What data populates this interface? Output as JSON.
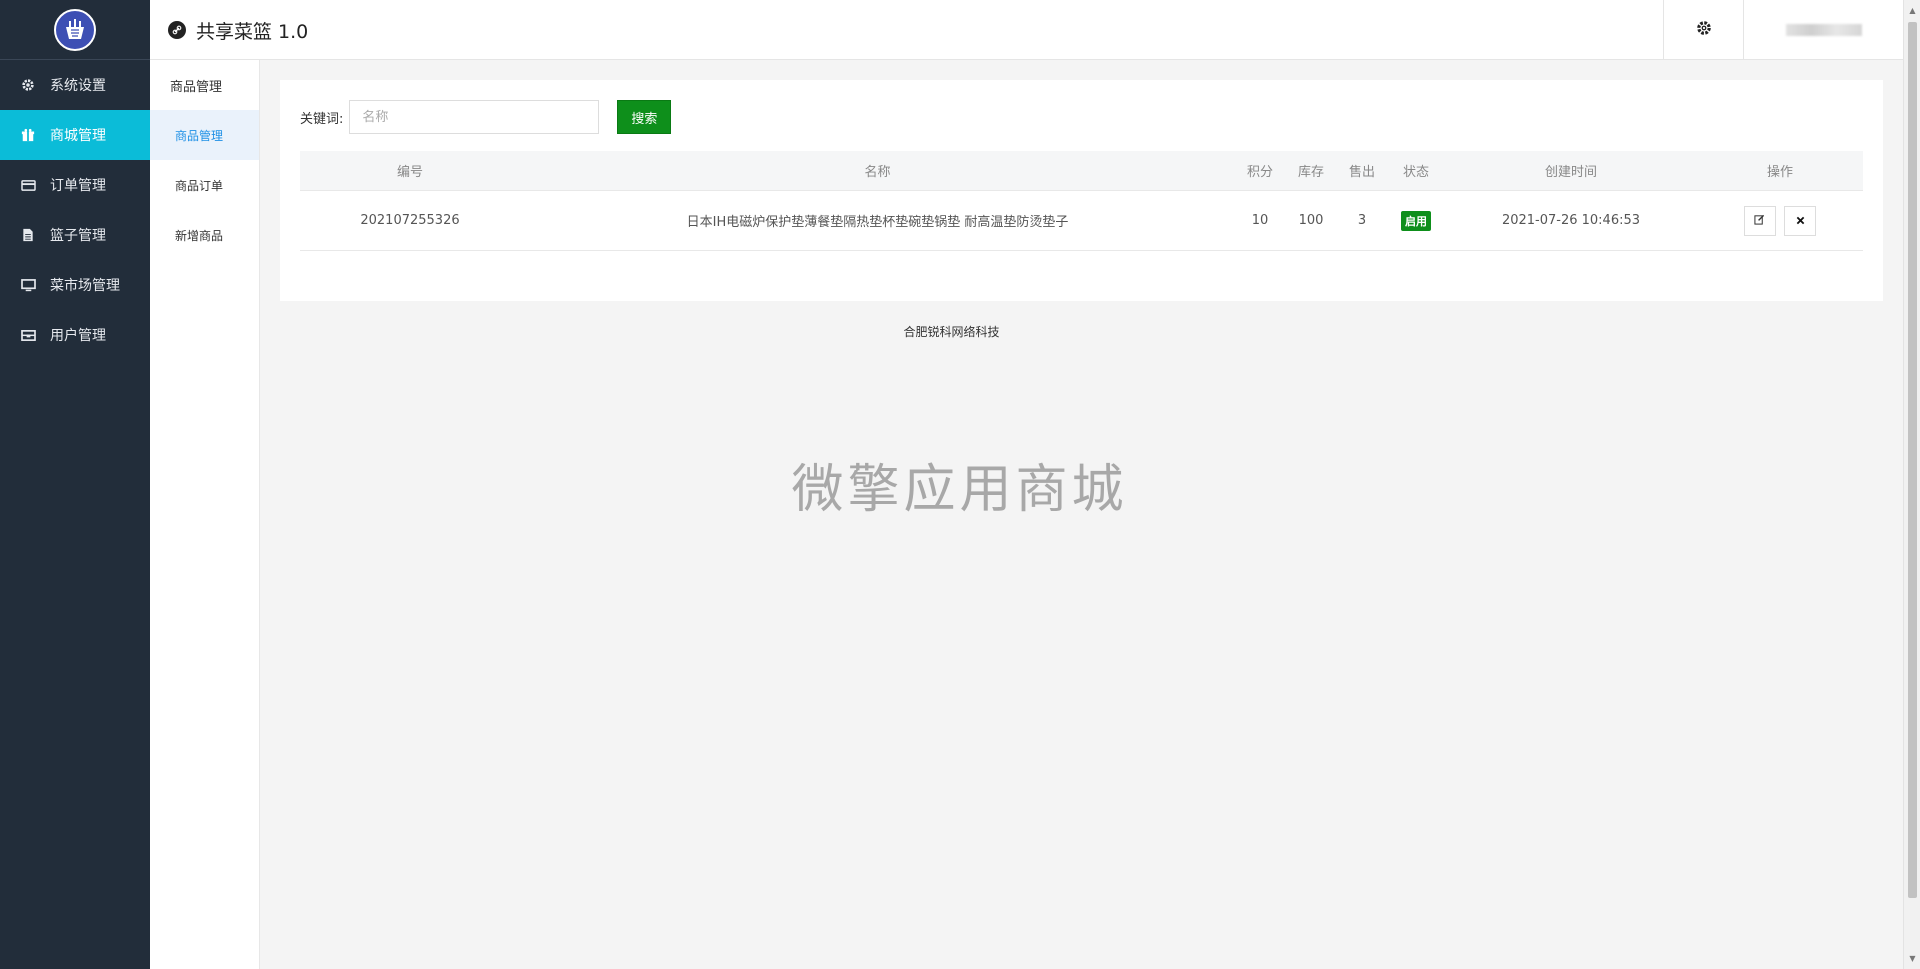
{
  "app": {
    "title": "共享菜篮 1.0"
  },
  "sidebar": {
    "items": [
      {
        "label": "系统设置",
        "icon": "gear-icon"
      },
      {
        "label": "商城管理",
        "icon": "gift-icon",
        "active": true
      },
      {
        "label": "订单管理",
        "icon": "card-icon"
      },
      {
        "label": "篮子管理",
        "icon": "file-icon"
      },
      {
        "label": "菜市场管理",
        "icon": "monitor-icon"
      },
      {
        "label": "用户管理",
        "icon": "inbox-icon"
      }
    ]
  },
  "subnav": {
    "heading": "商品管理",
    "items": [
      {
        "label": "商品管理",
        "active": true
      },
      {
        "label": "商品订单"
      },
      {
        "label": "新增商品"
      }
    ]
  },
  "search": {
    "label": "关键词:",
    "placeholder": "名称",
    "button": "搜索"
  },
  "table": {
    "headers": [
      "编号",
      "名称",
      "积分",
      "库存",
      "售出",
      "状态",
      "创建时间",
      "操作"
    ],
    "rows": [
      {
        "id": "202107255326",
        "name": "日本IH电磁炉保护垫薄餐垫隔热垫杯垫碗垫锅垫 耐高温垫防烫垫子",
        "points": "10",
        "stock": "100",
        "sold": "3",
        "status": "启用",
        "created": "2021-07-26 10:46:53"
      }
    ]
  },
  "footer": {
    "text": "合肥锐科网络科技"
  },
  "watermark": {
    "text": "微擎应用商城"
  },
  "colors": {
    "sidebar_bg": "#222d3a",
    "active": "#0bbcd8",
    "primary_green": "#0e8f1b",
    "sub_active": "#1e90e6"
  }
}
